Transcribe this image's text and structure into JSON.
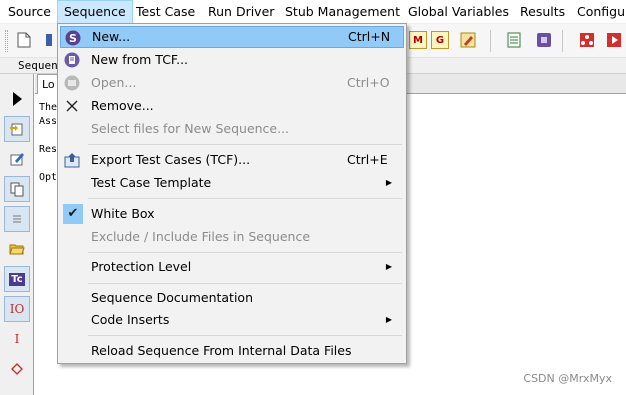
{
  "menubar": {
    "items": [
      {
        "label": "Source"
      },
      {
        "label": "Sequence"
      },
      {
        "label": "Test Case"
      },
      {
        "label": "Run Driver"
      },
      {
        "label": "Stub Management"
      },
      {
        "label": "Global Variables"
      },
      {
        "label": "Results"
      },
      {
        "label": "Configur"
      }
    ]
  },
  "secondary": {
    "tab_stub": "Sequen"
  },
  "log": {
    "tab_label": "Lo",
    "lines": [
      "The",
      "Ass",
      "Res",
      "Opt"
    ]
  },
  "dropdown": {
    "items": [
      {
        "label": "New...",
        "shortcut": "Ctrl+N",
        "state": "highlighted",
        "icon": "sequence-s-icon"
      },
      {
        "label": "New from TCF...",
        "shortcut": "",
        "state": "enabled",
        "icon": "sequence-tcf-icon"
      },
      {
        "label": "Open...",
        "shortcut": "Ctrl+O",
        "state": "disabled",
        "icon": "open-disabled-icon"
      },
      {
        "label": "Remove...",
        "shortcut": "",
        "state": "enabled",
        "icon": "x-remove-icon"
      },
      {
        "label": "Select files for New Sequence...",
        "shortcut": "",
        "state": "disabled",
        "icon": ""
      },
      {
        "label": "Export Test Cases (TCF)...",
        "shortcut": "Ctrl+E",
        "state": "enabled",
        "icon": "export-tcf-icon"
      },
      {
        "label": "Test Case Template",
        "shortcut": "",
        "state": "enabled",
        "submenu": true
      },
      {
        "label": "White Box",
        "shortcut": "",
        "state": "checked",
        "icon": "checkmark-icon"
      },
      {
        "label": "Exclude / Include Files in Sequence",
        "shortcut": "",
        "state": "disabled"
      },
      {
        "label": "Protection Level",
        "shortcut": "",
        "state": "enabled",
        "submenu": true
      },
      {
        "label": "Sequence Documentation",
        "shortcut": "",
        "state": "enabled"
      },
      {
        "label": "Code Inserts",
        "shortcut": "",
        "state": "enabled",
        "submenu": true
      },
      {
        "label": "Reload Sequence From Internal Data Files",
        "shortcut": "",
        "state": "enabled"
      }
    ]
  },
  "left_toolbar": {
    "tc_label": "Tc",
    "io_label": "IO",
    "i_label": "I"
  },
  "toolbar": {
    "g_label": "G"
  },
  "watermark": "CSDN @MrxMyx",
  "colors": {
    "menu_highlight": "#91c9f7",
    "menubar_active": "#cce8ff",
    "disabled_text": "#8c8c8c"
  }
}
